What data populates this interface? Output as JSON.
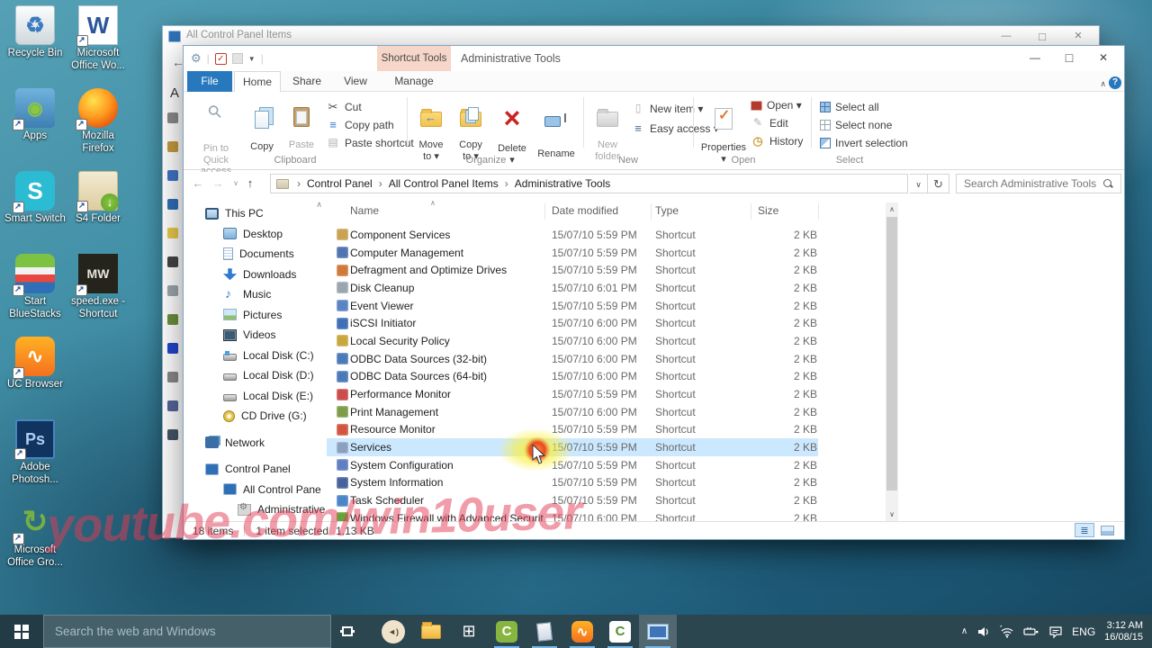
{
  "desktop": {
    "icons": [
      {
        "label": "Recycle Bin",
        "kind": "dk-recycle",
        "glyph": "♻",
        "sc": "nosc"
      },
      {
        "label": "Microsoft\nOffice Wo...",
        "kind": "dk-word",
        "glyph": "W",
        "sc": "sc"
      },
      {
        "label": "Apps",
        "kind": "dk-apps",
        "glyph": "◉",
        "sc": "sc"
      },
      {
        "label": "Mozilla\nFirefox",
        "kind": "dk-firefox",
        "glyph": "",
        "sc": "sc"
      },
      {
        "label": "Smart Switch",
        "kind": "dk-smart",
        "glyph": "S",
        "sc": "sc"
      },
      {
        "label": "S4 Folder",
        "kind": "dk-s4",
        "glyph": "↓",
        "sc": "sc"
      },
      {
        "label": "Start\nBlueStacks",
        "kind": "dk-bluestacks",
        "glyph": "",
        "sc": "sc"
      },
      {
        "label": "speed.exe -\nShortcut",
        "kind": "dk-speed",
        "glyph": "MW",
        "sc": "sc"
      },
      {
        "label": "UC Browser",
        "kind": "dk-uc",
        "glyph": "∿",
        "sc": "sc"
      },
      {
        "label": "Adobe\nPhotosh...",
        "kind": "dk-ps",
        "glyph": "Ps",
        "sc": "sc"
      },
      {
        "label": "Microsoft\nOffice Gro...",
        "kind": "dk-groove",
        "glyph": "↻",
        "sc": "sc"
      }
    ]
  },
  "bg_window": {
    "title": "All Control Panel Items",
    "partial_letter": "A",
    "sliver_icons": [
      {
        "c": "#8a8a8a"
      },
      {
        "c": "#c49a3f"
      },
      {
        "c": "#3f74c2"
      },
      {
        "c": "#2e6fb5"
      },
      {
        "c": "#e8c84a"
      },
      {
        "c": "#444444"
      },
      {
        "c": "#9aa5ad"
      },
      {
        "c": "#6a8f3f"
      },
      {
        "c": "#2244cc"
      },
      {
        "c": "#888888"
      },
      {
        "c": "#556699"
      },
      {
        "c": "#445566"
      }
    ]
  },
  "window": {
    "contextual_tab": "Shortcut Tools",
    "title": "Administrative Tools",
    "tabs": {
      "file": "File",
      "home": "Home",
      "share": "Share",
      "view": "View",
      "manage": "Manage"
    },
    "ribbon": {
      "clipboard": {
        "label": "Clipboard",
        "pin": "Pin to Quick\naccess",
        "copy": "Copy",
        "paste": "Paste",
        "cut": "Cut",
        "copy_path": "Copy path",
        "paste_shortcut": "Paste shortcut"
      },
      "organize": {
        "label": "Organize",
        "move_to": "Move\nto ▾",
        "copy_to": "Copy\nto ▾",
        "del": "Delete\n▾",
        "rename": "Rename"
      },
      "new_grp": {
        "label": "New",
        "new_folder": "New\nfolder",
        "new_item": "New item ▾",
        "easy_access": "Easy access ▾"
      },
      "open_grp": {
        "label": "Open",
        "properties": "Properties\n▾",
        "open": "Open ▾",
        "edit": "Edit",
        "history": "History"
      },
      "select_grp": {
        "label": "Select",
        "all": "Select all",
        "none": "Select none",
        "invert": "Invert selection"
      }
    },
    "address": {
      "crumbs": [
        {
          "label": "Control Panel"
        },
        {
          "label": "All Control Panel Items"
        },
        {
          "label": "Administrative Tools"
        }
      ],
      "search_placeholder": "Search Administrative Tools"
    },
    "nav": [
      {
        "label": "This PC",
        "icon": "ni-pc",
        "lv": "lv0"
      },
      {
        "label": "Desktop",
        "icon": "ni-desk",
        "lv": "lv1"
      },
      {
        "label": "Documents",
        "icon": "ni-docs",
        "lv": "lv1"
      },
      {
        "label": "Downloads",
        "icon": "ni-down",
        "lv": "lv1"
      },
      {
        "label": "Music",
        "icon": "ni-music",
        "lv": "lv1"
      },
      {
        "label": "Pictures",
        "icon": "ni-pics",
        "lv": "lv1"
      },
      {
        "label": "Videos",
        "icon": "ni-vids",
        "lv": "lv1"
      },
      {
        "label": "Local Disk (C:)",
        "icon": "ni-disk ni-disk-c",
        "lv": "lv1"
      },
      {
        "label": "Local Disk (D:)",
        "icon": "ni-disk",
        "lv": "lv1"
      },
      {
        "label": "Local Disk (E:)",
        "icon": "ni-disk",
        "lv": "lv1"
      },
      {
        "label": "CD Drive (G:)",
        "icon": "ni-cd",
        "lv": "lv1"
      },
      {
        "label": "Network",
        "icon": "ni-net",
        "lv": "lv0 gap"
      },
      {
        "label": "Control Panel",
        "icon": "ni-cpl",
        "lv": "lv0 gap"
      },
      {
        "label": "All Control Pane",
        "icon": "ni-cpl",
        "lv": "lv1"
      },
      {
        "label": "Administrative",
        "icon": "ni-admin",
        "lv": "lv2",
        "state": "current",
        "suffix": "∨"
      }
    ],
    "list": {
      "columns": {
        "name": "Name",
        "date": "Date modified",
        "type": "Type",
        "size": "Size"
      },
      "rows": [
        {
          "name": "Component Services",
          "date": "15/07/10 5:59 PM",
          "type": "Shortcut",
          "size": "2 KB",
          "icon": "#c9a254"
        },
        {
          "name": "Computer Management",
          "date": "15/07/10 5:59 PM",
          "type": "Shortcut",
          "size": "2 KB",
          "icon": "#4f74b0"
        },
        {
          "name": "Defragment and Optimize Drives",
          "date": "15/07/10 5:59 PM",
          "type": "Shortcut",
          "size": "2 KB",
          "icon": "#d07a3a"
        },
        {
          "name": "Disk Cleanup",
          "date": "15/07/10 6:01 PM",
          "type": "Shortcut",
          "size": "2 KB",
          "icon": "#9aa5ad"
        },
        {
          "name": "Event Viewer",
          "date": "15/07/10 5:59 PM",
          "type": "Shortcut",
          "size": "2 KB",
          "icon": "#5b84c4"
        },
        {
          "name": "iSCSI Initiator",
          "date": "15/07/10 6:00 PM",
          "type": "Shortcut",
          "size": "2 KB",
          "icon": "#3f6fb5"
        },
        {
          "name": "Local Security Policy",
          "date": "15/07/10 6:00 PM",
          "type": "Shortcut",
          "size": "2 KB",
          "icon": "#c9a63d"
        },
        {
          "name": "ODBC Data Sources (32-bit)",
          "date": "15/07/10 6:00 PM",
          "type": "Shortcut",
          "size": "2 KB",
          "icon": "#4a7ab8"
        },
        {
          "name": "ODBC Data Sources (64-bit)",
          "date": "15/07/10 6:00 PM",
          "type": "Shortcut",
          "size": "2 KB",
          "icon": "#4a7ab8"
        },
        {
          "name": "Performance Monitor",
          "date": "15/07/10 5:59 PM",
          "type": "Shortcut",
          "size": "2 KB",
          "icon": "#cc4b4b"
        },
        {
          "name": "Print Management",
          "date": "15/07/10 6:00 PM",
          "type": "Shortcut",
          "size": "2 KB",
          "icon": "#7f9c4a"
        },
        {
          "name": "Resource Monitor",
          "date": "15/07/10 5:59 PM",
          "type": "Shortcut",
          "size": "2 KB",
          "icon": "#d2553f"
        },
        {
          "name": "Services",
          "date": "15/07/10 5:59 PM",
          "type": "Shortcut",
          "size": "2 KB",
          "icon": "#8aa0bf",
          "state": "selected"
        },
        {
          "name": "System Configuration",
          "date": "15/07/10 5:59 PM",
          "type": "Shortcut",
          "size": "2 KB",
          "icon": "#5f7fc4"
        },
        {
          "name": "System Information",
          "date": "15/07/10 5:59 PM",
          "type": "Shortcut",
          "size": "2 KB",
          "icon": "#47639c"
        },
        {
          "name": "Task Scheduler",
          "date": "15/07/10 5:59 PM",
          "type": "Shortcut",
          "size": "2 KB",
          "icon": "#4a86c8"
        },
        {
          "name": "Windows Firewall with Advanced Security",
          "date": "15/07/10 6:00 PM",
          "type": "Shortcut",
          "size": "2 KB",
          "icon": "#63a637"
        }
      ]
    },
    "status": {
      "items": "18 items",
      "selected": "1 item selected",
      "size": "1.13 KB"
    }
  },
  "watermark": "youtube.com/win10user",
  "taskbar": {
    "search_placeholder": "Search the web and Windows",
    "apps": [
      {
        "kind": "tb-vol",
        "glyph": "◄)",
        "run": "run-no"
      },
      {
        "kind": "tb-explorer",
        "glyph": "",
        "run": "run-no"
      },
      {
        "kind": "tb-store",
        "glyph": "⊞",
        "run": "run-no"
      },
      {
        "kind": "tb-camtasia",
        "glyph": "C",
        "run": "run-yes"
      },
      {
        "kind": "tb-notepad",
        "glyph": "",
        "run": "run-yes"
      },
      {
        "kind": "tb-uc",
        "glyph": "∿",
        "run": "run-yes"
      },
      {
        "kind": "tb-camtasia2",
        "glyph": "C",
        "run": "run-yes"
      },
      {
        "kind": "tb-cpanel",
        "glyph": "",
        "run": "run-yes",
        "state": "active"
      }
    ],
    "tray": {
      "lang": "ENG",
      "time": "3:12 AM",
      "date": "16/08/15"
    }
  }
}
